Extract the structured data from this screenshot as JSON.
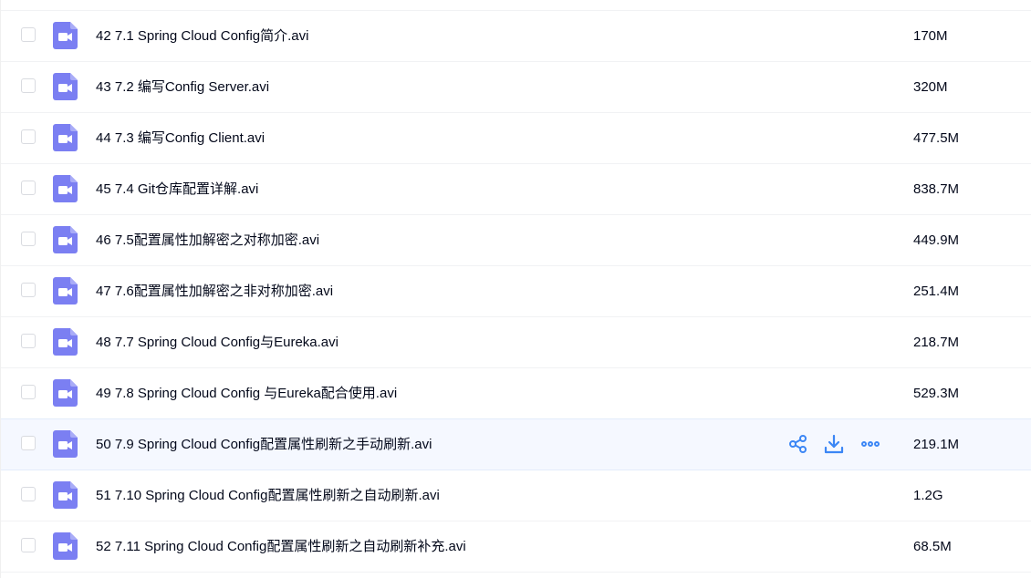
{
  "files": [
    {
      "name": "42 7.1 Spring Cloud Config简介.avi",
      "size": "170M",
      "icon": "video-file-icon"
    },
    {
      "name": "43 7.2 编写Config Server.avi",
      "size": "320M",
      "icon": "video-file-icon"
    },
    {
      "name": "44 7.3 编写Config Client.avi",
      "size": "477.5M",
      "icon": "video-file-icon"
    },
    {
      "name": "45 7.4 Git仓库配置详解.avi",
      "size": "838.7M",
      "icon": "video-file-icon"
    },
    {
      "name": "46 7.5配置属性加解密之对称加密.avi",
      "size": "449.9M",
      "icon": "video-file-icon"
    },
    {
      "name": "47 7.6配置属性加解密之非对称加密.avi",
      "size": "251.4M",
      "icon": "video-file-icon"
    },
    {
      "name": "48 7.7 Spring Cloud Config与Eureka.avi",
      "size": "218.7M",
      "icon": "video-file-icon"
    },
    {
      "name": "49 7.8 Spring Cloud Config 与Eureka配合使用.avi",
      "size": "529.3M",
      "icon": "video-file-icon"
    },
    {
      "name": "50 7.9 Spring Cloud Config配置属性刷新之手动刷新.avi",
      "size": "219.1M",
      "icon": "video-file-icon",
      "hovered": true
    },
    {
      "name": "51 7.10 Spring Cloud Config配置属性刷新之自动刷新.avi",
      "size": "1.2G",
      "icon": "video-file-icon"
    },
    {
      "name": "52 7.11 Spring Cloud Config配置属性刷新之自动刷新补充.avi",
      "size": "68.5M",
      "icon": "video-file-icon"
    }
  ],
  "row_actions": [
    "share-icon",
    "download-icon",
    "more-icon"
  ],
  "colors": {
    "icon_bg": "#7b7ff2",
    "action": "#3b86f5",
    "hover_row": "#f5f8ff",
    "text": "#03081a"
  }
}
